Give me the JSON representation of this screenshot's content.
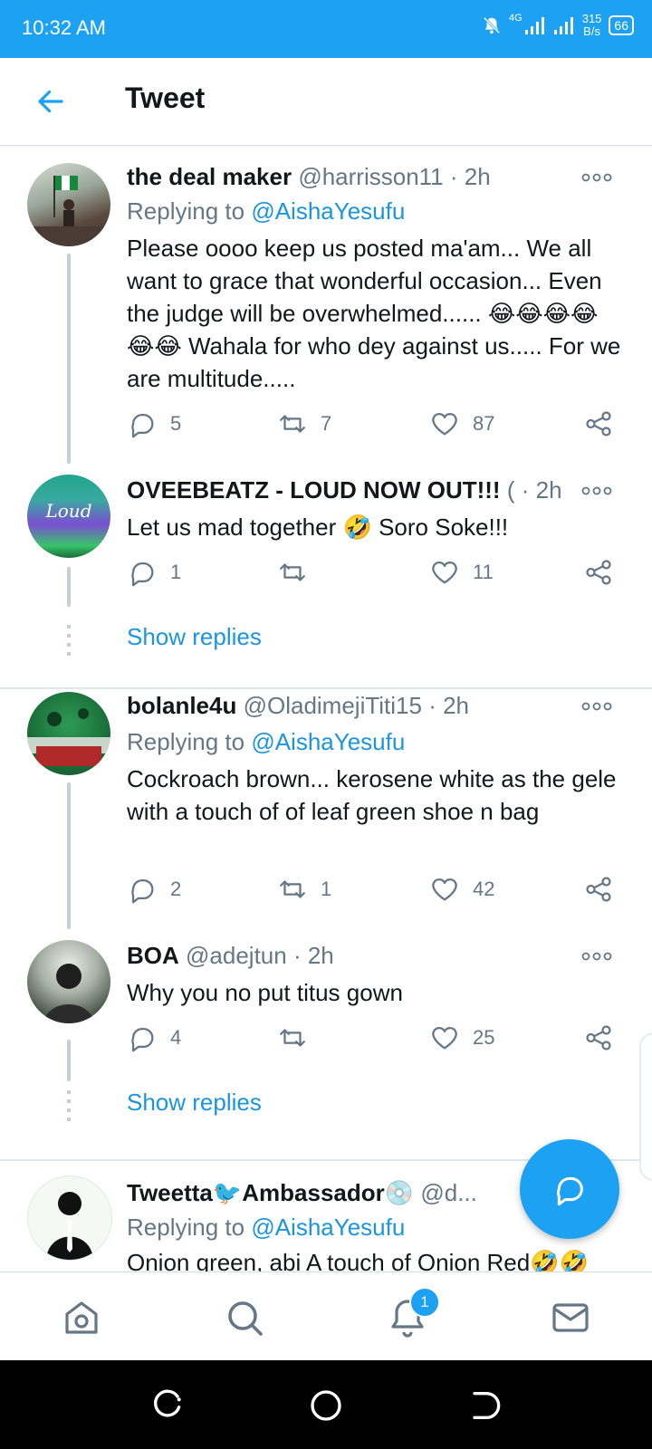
{
  "status_bar": {
    "time": "10:32 AM",
    "network": "4G",
    "net_speed_value": "315",
    "net_speed_unit": "B/s",
    "battery": "66",
    "icons": [
      "mute-bell-icon",
      "signal-icon",
      "signal-icon",
      "battery-icon"
    ]
  },
  "header": {
    "title": "Tweet",
    "back_icon": "arrow-left-icon"
  },
  "tweets": [
    {
      "name": "the deal maker",
      "handle": "@harrisson11",
      "time": "· 2h",
      "replying_label": "Replying to",
      "replying_to": "@AishaYesufu",
      "text": "Please oooo keep us posted ma'am... We all want to grace that wonderful occasion... Even the judge will be overwhelmed...... 😂😂😂😂😂😂 Wahala for who dey against us..... For we are multitude.....",
      "replies": "5",
      "retweets": "7",
      "likes": "87"
    },
    {
      "name": "OVEEBEATZ - LOUD NOW OUT!!!",
      "handle": "(",
      "time": "· 2h",
      "text": "Let us mad together 🤣 Soro Soke!!!",
      "replies": "1",
      "retweets": "",
      "likes": "11",
      "avatar_text": "Loud",
      "show_replies": "Show replies"
    },
    {
      "name": "bolanle4u",
      "handle": "@OladimejiTiti15",
      "time": "· 2h",
      "replying_label": "Replying to",
      "replying_to": "@AishaYesufu",
      "text": "Cockroach brown... kerosene white as the gele with a touch of of leaf green shoe n bag",
      "replies": "2",
      "retweets": "1",
      "likes": "42"
    },
    {
      "name": "BOA",
      "handle": "@adejtun",
      "time": "· 2h",
      "text": "Why you no put titus gown",
      "replies": "4",
      "retweets": "",
      "likes": "25",
      "show_replies": "Show replies"
    },
    {
      "name": "Tweetta🐦Ambassador💿",
      "handle": "@d...",
      "replying_label": "Replying to",
      "replying_to": "@AishaYesufu",
      "text": "Onion green, abi A touch of Onion Red🤣🤣"
    }
  ],
  "tabbar": {
    "items": [
      "home-icon",
      "search-icon",
      "notifications-icon",
      "messages-icon"
    ],
    "notification_count": "1"
  },
  "colors": {
    "accent": "#1da1f2",
    "muted": "#657786",
    "text": "#14171a",
    "separator": "#e1e8ed"
  }
}
